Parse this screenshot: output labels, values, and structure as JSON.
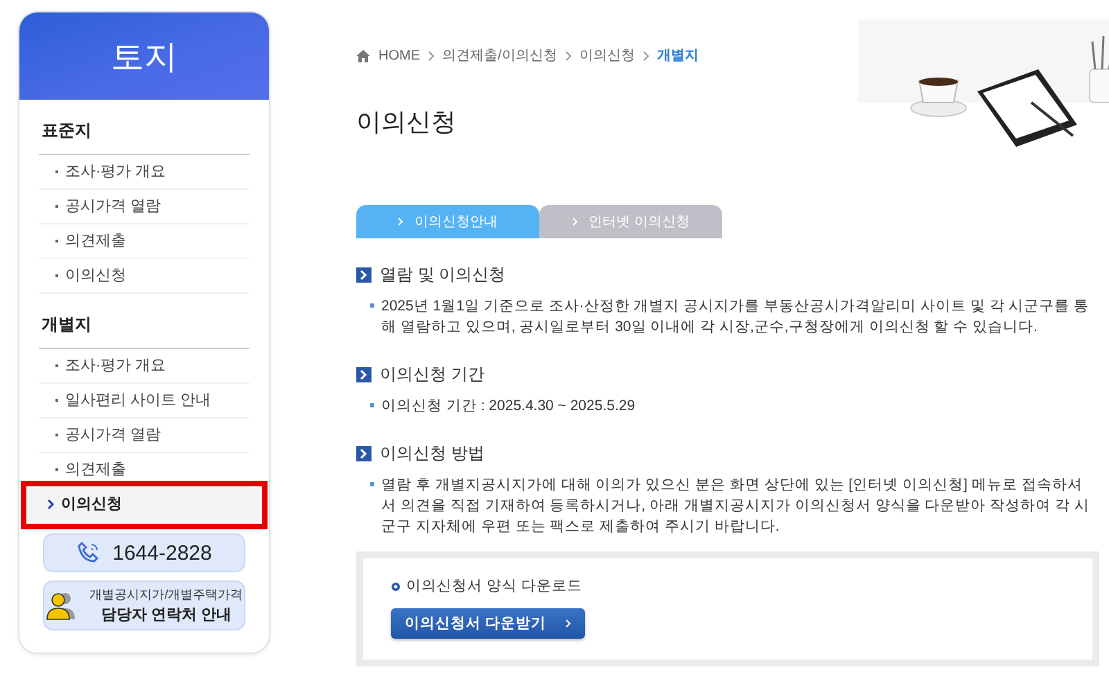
{
  "sidebar": {
    "title": "토지",
    "groups": [
      {
        "label": "표준지",
        "items": [
          {
            "label": "조사·평가 개요",
            "selected": false,
            "marked": false
          },
          {
            "label": "공시가격 열람",
            "selected": false,
            "marked": false
          },
          {
            "label": "의견제출",
            "selected": false,
            "marked": false
          },
          {
            "label": "이의신청",
            "selected": false,
            "marked": false
          }
        ]
      },
      {
        "label": "개별지",
        "items": [
          {
            "label": "조사·평가 개요",
            "selected": false,
            "marked": false
          },
          {
            "label": "일사편리 사이트 안내",
            "selected": false,
            "marked": false
          },
          {
            "label": "공시가격 열람",
            "selected": false,
            "marked": false
          },
          {
            "label": "의견제출",
            "selected": false,
            "marked": false
          },
          {
            "label": "이의신청",
            "selected": true,
            "marked": true
          }
        ]
      }
    ],
    "phone": "1644-2828",
    "contact": {
      "line1": "개별공시지가/개별주택가격",
      "line2": "담당자 연락처 안내"
    }
  },
  "breadcrumb": [
    {
      "label": "HOME",
      "current": false
    },
    {
      "label": "의견제출/이의신청",
      "current": false
    },
    {
      "label": "이의신청",
      "current": false
    },
    {
      "label": "개별지",
      "current": true
    }
  ],
  "page_title": "이의신청",
  "tabs": [
    {
      "label": "이의신청안내",
      "selected": true
    },
    {
      "label": "인터넷 이의신청",
      "selected": false
    }
  ],
  "sections": [
    {
      "heading": "열람 및 이의신청",
      "text": "2025년 1월1일 기준으로 조사·산정한 개별지 공시지가를 부동산공시가격알리미 사이트 및 각 시군구를 통해 열람하고 있으며, 공시일로부터 30일 이내에 각 시장,군수,구청장에게 이의신청 할 수 있습니다."
    },
    {
      "heading": "이의신청 기간",
      "text": "이의신청 기간 : 2025.4.30 ~ 2025.5.29"
    },
    {
      "heading": "이의신청 방법",
      "text": "열람 후 개별지공시지가에 대해 이의가 있으신 분은 화면 상단에 있는 [인터넷 이의신청] 메뉴로 접속하셔서 의견을 직접 기재하여 등록하시거나, 아래 개별지공시지가 이의신청서 양식을 다운받아 작성하여 각 시군구 지자체에 우편 또는 팩스로 제출하여 주시기 바랍니다."
    }
  ],
  "download": {
    "label": "이의신청서 양식 다운로드",
    "button": "이의신청서 다운받기"
  }
}
